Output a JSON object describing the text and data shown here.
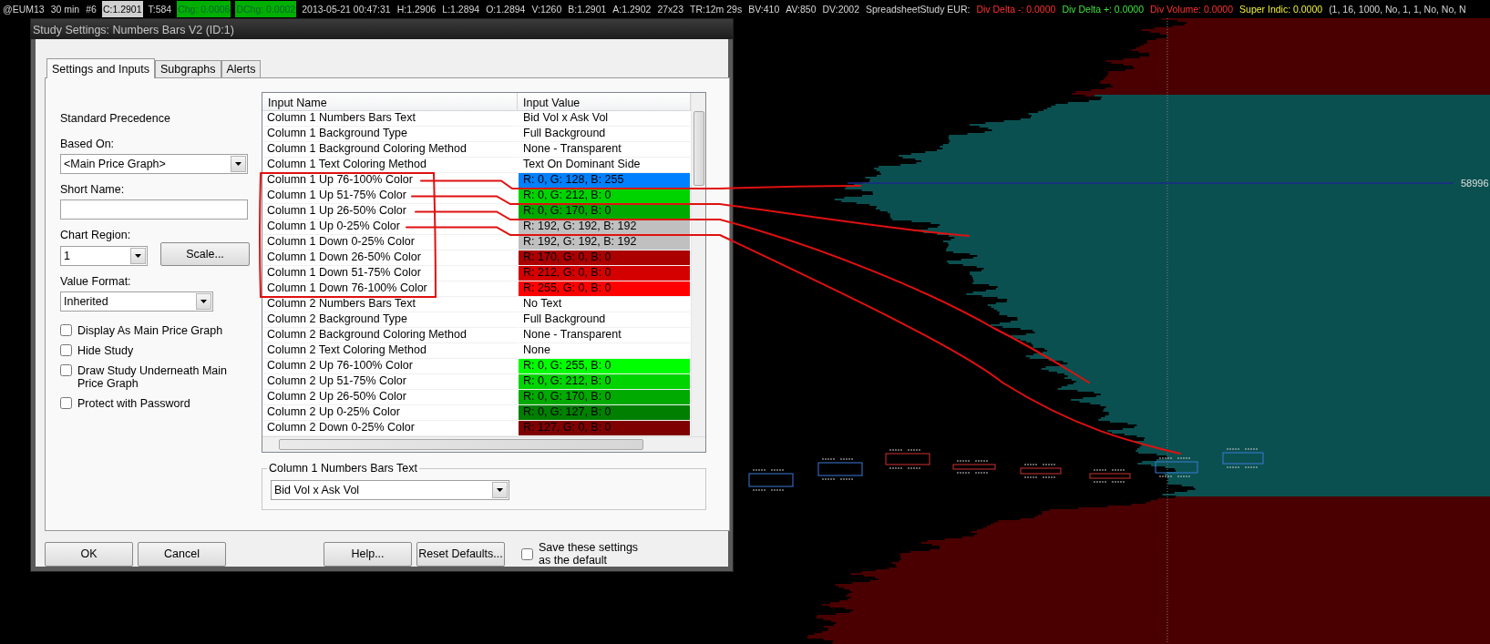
{
  "status_bar": {
    "segments": [
      {
        "text": "@EUM13",
        "kind": "plain"
      },
      {
        "text": "30 min",
        "kind": "plain"
      },
      {
        "text": "#6",
        "kind": "plain"
      },
      {
        "text": "C:1.2901",
        "kind": "inverse"
      },
      {
        "text": "T:584",
        "kind": "plain"
      },
      {
        "text": "Chg: 0.0006",
        "kind": "green-box"
      },
      {
        "text": "DChg: 0.0002",
        "kind": "green-box"
      },
      {
        "text": "2013-05-21 00:47:31",
        "kind": "plain"
      },
      {
        "text": "H:1.2906",
        "kind": "plain"
      },
      {
        "text": "L:1.2894",
        "kind": "plain"
      },
      {
        "text": "O:1.2894",
        "kind": "plain"
      },
      {
        "text": "V:1260",
        "kind": "plain"
      },
      {
        "text": "B:1.2901",
        "kind": "plain"
      },
      {
        "text": "A:1.2902",
        "kind": "plain"
      },
      {
        "text": "27x23",
        "kind": "plain"
      },
      {
        "text": "TR:12m 29s",
        "kind": "plain"
      },
      {
        "text": "BV:410",
        "kind": "plain"
      },
      {
        "text": "AV:850",
        "kind": "plain"
      },
      {
        "text": "DV:2002",
        "kind": "plain"
      },
      {
        "text": "SpreadsheetStudy EUR:",
        "kind": "plain"
      },
      {
        "text": "Div Delta -: 0.0000",
        "kind": "red"
      },
      {
        "text": "Div Delta +: 0.0000",
        "kind": "green"
      },
      {
        "text": "Div Volume: 0.0000",
        "kind": "red"
      },
      {
        "text": "Super Indic: 0.0000",
        "kind": "yellow"
      },
      {
        "text": "(1, 16, 1000, No, 1, 1, No, No, N",
        "kind": "plain"
      }
    ]
  },
  "chart": {
    "price_label": "58996"
  },
  "dialog": {
    "title": "Study Settings: Numbers Bars V2 (ID:1)",
    "tabs": [
      {
        "label": "Settings and Inputs",
        "selected": true
      },
      {
        "label": "Subgraphs",
        "selected": false
      },
      {
        "label": "Alerts",
        "selected": false
      }
    ],
    "left_panel": {
      "heading": "Standard Precedence",
      "based_on": {
        "label": "Based On:",
        "value": "<Main Price Graph>"
      },
      "short_name": {
        "label": "Short Name:"
      },
      "chart_region": {
        "label": "Chart Region:",
        "value": "1"
      },
      "scale_button": "Scale...",
      "value_format": {
        "label": "Value Format:",
        "value": "Inherited"
      },
      "checkboxes": [
        {
          "label": "Display As Main Price Graph",
          "checked": false
        },
        {
          "label": "Hide Study",
          "checked": false
        },
        {
          "label": "Draw Study Underneath Main Price Graph",
          "checked": false
        },
        {
          "label": "Protect with Password",
          "checked": false
        }
      ]
    },
    "inputs_table": {
      "columns": [
        "Input Name",
        "Input Value"
      ],
      "rows": [
        {
          "name": "Column 1 Numbers Bars Text",
          "value": "Bid Vol x Ask Vol"
        },
        {
          "name": "Column 1 Background Type",
          "value": "Full Background"
        },
        {
          "name": "Column 1 Background Coloring Method",
          "value": "None - Transparent"
        },
        {
          "name": "Column 1 Text Coloring Method",
          "value": "Text On Dominant Side"
        },
        {
          "name": "Column 1 Up 76-100% Color",
          "value": "R: 0, G: 128, B: 255",
          "color": "#0080ff"
        },
        {
          "name": "Column 1 Up 51-75% Color",
          "value": "R: 0, G: 212, B: 0",
          "color": "#00d400"
        },
        {
          "name": "Column 1 Up 26-50% Color",
          "value": "R: 0, G: 170, B: 0",
          "color": "#00aa00"
        },
        {
          "name": "Column 1 Up 0-25% Color",
          "value": "R: 192, G: 192, B: 192",
          "color": "#c0c0c0"
        },
        {
          "name": "Column 1 Down 0-25% Color",
          "value": "R: 192, G: 192, B: 192",
          "color": "#c0c0c0"
        },
        {
          "name": "Column 1 Down 26-50% Color",
          "value": "R: 170, G: 0, B: 0",
          "color": "#aa0000"
        },
        {
          "name": "Column 1 Down 51-75% Color",
          "value": "R: 212, G: 0, B: 0",
          "color": "#d40000"
        },
        {
          "name": "Column 1 Down 76-100% Color",
          "value": "R: 255, G: 0, B: 0",
          "color": "#ff0000"
        },
        {
          "name": "Column 2 Numbers Bars Text",
          "value": "No Text"
        },
        {
          "name": "Column 2 Background Type",
          "value": "Full Background"
        },
        {
          "name": "Column 2 Background Coloring Method",
          "value": "None - Transparent"
        },
        {
          "name": "Column 2 Text Coloring Method",
          "value": "None"
        },
        {
          "name": "Column 2 Up 76-100% Color",
          "value": "R: 0, G: 255, B: 0",
          "color": "#00ff00"
        },
        {
          "name": "Column 2 Up 51-75% Color",
          "value": "R: 0, G: 212, B: 0",
          "color": "#00d400"
        },
        {
          "name": "Column 2 Up 26-50% Color",
          "value": "R: 0, G: 170, B: 0",
          "color": "#00aa00"
        },
        {
          "name": "Column 2 Up 0-25% Color",
          "value": "R: 0, G: 127, B: 0",
          "color": "#007f00"
        },
        {
          "name": "Column 2 Down 0-25% Color",
          "value": "R: 127, G: 0, B: 0",
          "color": "#7f0000"
        }
      ]
    },
    "selected_input": {
      "label": "Column 1 Numbers Bars Text",
      "value": "Bid Vol x Ask Vol"
    },
    "buttons": [
      "OK",
      "Cancel",
      "Help...",
      "Reset Defaults..."
    ],
    "save_default": {
      "label": "Save these settings as the default",
      "checked": false
    }
  }
}
